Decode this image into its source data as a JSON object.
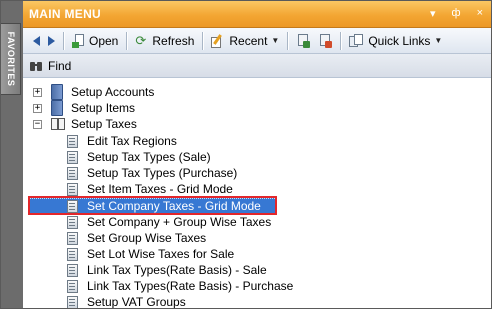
{
  "favorites_tab": "FAVORITES",
  "title": "MAIN MENU",
  "title_controls": {
    "dropdown": "▾",
    "pin": "ф",
    "close": "×"
  },
  "toolbar": {
    "open_label": "Open",
    "refresh_label": "Refresh",
    "recent_label": "Recent",
    "quick_links_label": "Quick Links"
  },
  "find_label": "Find",
  "tree": {
    "setup_accounts": "Setup Accounts",
    "setup_items": "Setup Items",
    "setup_taxes": "Setup Taxes",
    "children": [
      "Edit Tax Regions",
      "Setup Tax Types (Sale)",
      "Setup Tax Types (Purchase)",
      "Set Item Taxes - Grid Mode",
      "Set Company Taxes - Grid Mode",
      "Set Company + Group Wise Taxes",
      "Set Group Wise Taxes",
      "Set Lot Wise Taxes for Sale",
      "Link Tax Types(Rate Basis) - Sale",
      "Link Tax Types(Rate Basis) - Purchase",
      "Setup VAT Groups"
    ],
    "selected_item": "Set Company Taxes - Grid Mode"
  },
  "colors": {
    "title_orange": "#f3a633",
    "selection_blue": "#3778d3",
    "highlight_red": "#e3262b"
  }
}
